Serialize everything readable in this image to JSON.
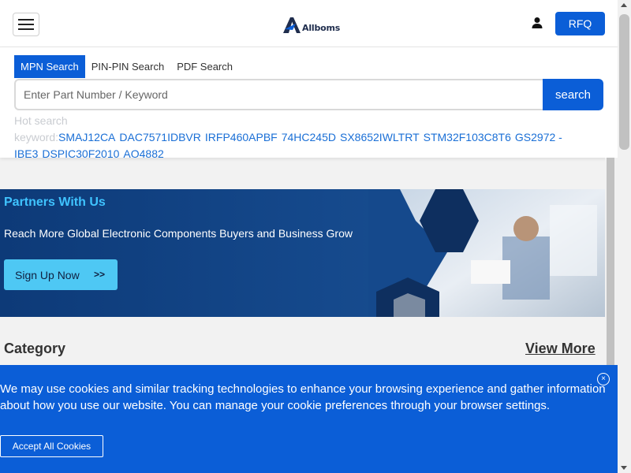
{
  "header": {
    "logo_text": "Allboms",
    "rfq_label": "RFQ",
    "icons": {
      "menu": "hamburger-menu-icon",
      "user": "user-icon"
    }
  },
  "search": {
    "tabs": [
      {
        "label": "MPN Search",
        "active": true
      },
      {
        "label": "PIN-PIN Search",
        "active": false
      },
      {
        "label": "PDF Search",
        "active": false
      }
    ],
    "placeholder": "Enter Part Number / Keyword",
    "button_label": "search",
    "hot_label": "Hot search keyword:",
    "hot_keywords": [
      "SMAJ12CA",
      "DAC7571IDBVR",
      "IRFP460APBF",
      "74HC245D",
      "SX8652IWLTRT",
      "STM32F103C8T6",
      "GS2972 - IBE3",
      "DSPIC30F2010",
      "AO4882"
    ]
  },
  "banner": {
    "title": "Partners With Us",
    "subtitle": "Reach More Global Electronic Components Buyers and Business Grow",
    "button_label": "Sign Up Now",
    "button_chevron": ">>"
  },
  "category": {
    "title": "Category",
    "view_more": "View More"
  },
  "cookie": {
    "text": "We may use cookies and similar tracking technologies to enhance your browsing experience and gather information about how you use our website. You can manage your cookie preferences through your browser settings.",
    "accept_label": "Accept All Cookies",
    "close_glyph": "×"
  },
  "colors": {
    "primary": "#0b5ed7",
    "banner_title": "#3fc3ff",
    "signup_button": "#4ec8f4",
    "hot_keyword_link": "#1a6fd6"
  }
}
